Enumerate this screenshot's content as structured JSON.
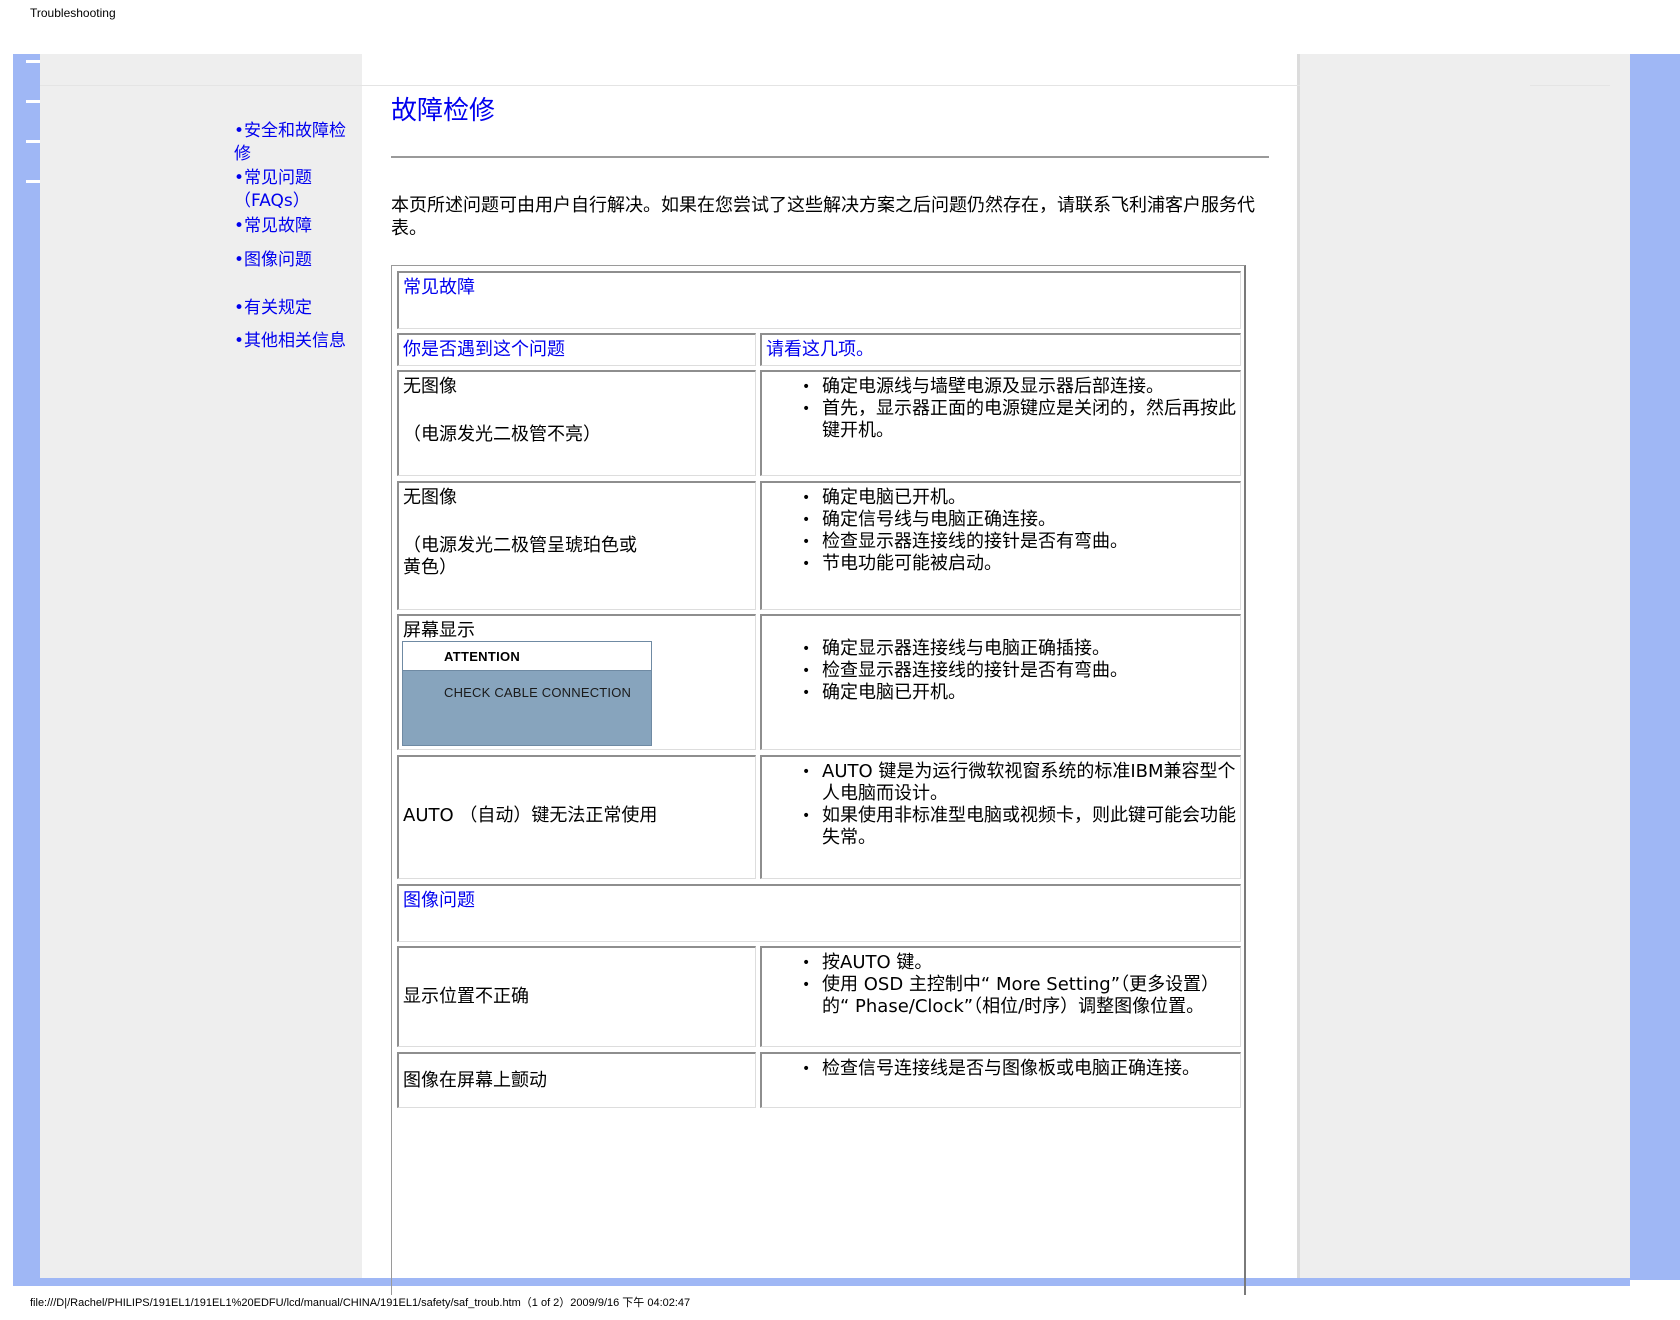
{
  "header": {
    "title": "Troubleshooting"
  },
  "footer": {
    "path": "file:///D|/Rachel/PHILIPS/191EL1/191EL1%20EDFU/lcd/manual/CHINA/191EL1/safety/saf_troub.htm（1 of 2）2009/9/16 下午 04:02:47"
  },
  "nav": {
    "items": [
      {
        "label": "•安全和故障检修"
      },
      {
        "label": "•常见问题（FAQs）"
      },
      {
        "label": "•常见故障"
      },
      {
        "label": "•图像问题"
      },
      {
        "label": "•有关规定"
      },
      {
        "label": "•其他相关信息"
      }
    ]
  },
  "main": {
    "title": "故障检修",
    "intro": "本页所述问题可由用户自行解决。如果在您尝试了这些解决方案之后问题仍然存在，请联系飞利浦客户服务代表。",
    "section_common": "常见故障",
    "col_problem": "你是否遇到这个问题",
    "col_check": "请看这几项。",
    "rows": [
      {
        "problem": "无图像",
        "problem_note": "（电源发光二极管不亮）",
        "checks": [
          "确定电源线与墙壁电源及显示器后部连接。",
          "首先，显示器正面的电源键应是关闭的，然后再按此键开机。"
        ]
      },
      {
        "problem": "无图像",
        "problem_note": "（电源发光二极管呈琥珀色或黄色）",
        "checks": [
          "确定电脑已开机。",
          "确定信号线与电脑正确连接。",
          "检查显示器连接线的接针是否有弯曲。",
          "节电功能可能被启动。"
        ]
      },
      {
        "problem": "屏幕显示",
        "osd_title": "ATTENTION",
        "osd_message": "CHECK CABLE CONNECTION",
        "checks": [
          "确定显示器连接线与电脑正确插接。",
          "检查显示器连接线的接针是否有弯曲。",
          "确定电脑已开机。"
        ]
      },
      {
        "problem": "AUTO （自动）键无法正常使用",
        "checks": [
          "AUTO 键是为运行微软视窗系统的标准IBM兼容型个人电脑而设计。",
          "如果使用非标准型电脑或视频卡，则此键可能会功能失常。"
        ]
      }
    ],
    "section_image": "图像问题",
    "image_rows": [
      {
        "problem": "显示位置不正确",
        "checks": [
          "按AUTO 键。",
          "使用 OSD 主控制中“ More Setting”（更多设置）的“ Phase/Clock”（相位/时序）调整图像位置。"
        ]
      },
      {
        "problem": "图像在屏幕上颤动",
        "checks": [
          "检查信号连接线是否与图像板或电脑正确连接。"
        ]
      }
    ]
  }
}
